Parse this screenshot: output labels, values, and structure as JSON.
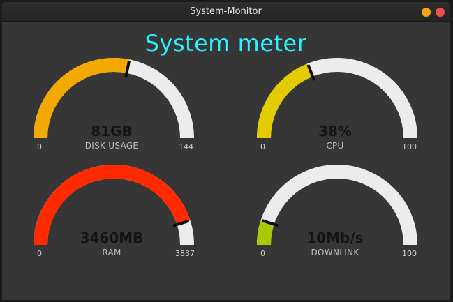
{
  "window": {
    "title": "System-Monitor"
  },
  "heading": "System meter",
  "gauges": [
    {
      "value_text": "81GB",
      "label": "DISK USAGE",
      "min": "0",
      "max": "144",
      "fraction": 0.5625,
      "color": "#f4a900"
    },
    {
      "value_text": "38%",
      "label": "CPU",
      "min": "0",
      "max": "100",
      "fraction": 0.38,
      "color": "#e2cb00"
    },
    {
      "value_text": "3460MB",
      "label": "RAM",
      "min": "0",
      "max": "3837",
      "fraction": 0.9018,
      "color": "#ff2a00"
    },
    {
      "value_text": "10Mb/s",
      "label": "DOWNLINK",
      "min": "0",
      "max": "100",
      "fraction": 0.1,
      "color": "#a8c800"
    }
  ],
  "colors": {
    "track": "#ececec",
    "needle": "#0a0a0a",
    "heading": "#2af0ff"
  }
}
